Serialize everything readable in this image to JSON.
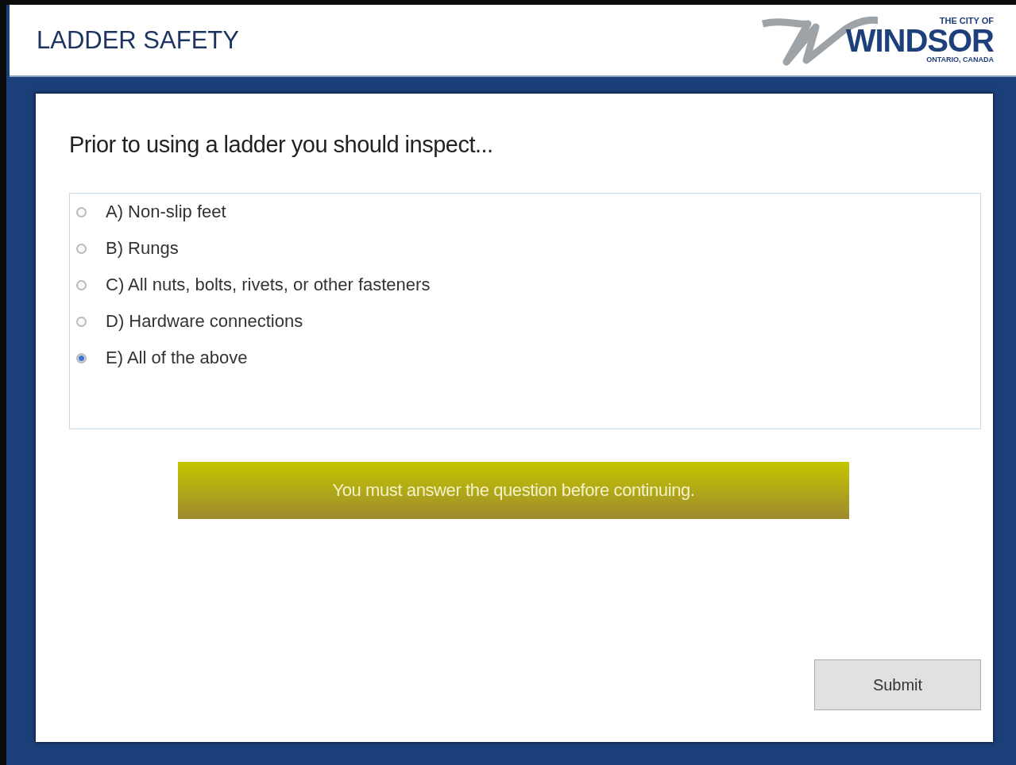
{
  "header": {
    "title": "LADDER SAFETY",
    "logo": {
      "top_line": "THE CITY OF",
      "name": "WINDSOR",
      "bottom_line": "ONTARIO, CANADA"
    }
  },
  "question": {
    "prompt": "Prior to using a ladder you should inspect...",
    "options": [
      {
        "label": "A) Non-slip feet",
        "selected": false
      },
      {
        "label": "B) Rungs",
        "selected": false
      },
      {
        "label": "C) All nuts, bolts, rivets, or other fasteners",
        "selected": false
      },
      {
        "label": "D) Hardware connections",
        "selected": false
      },
      {
        "label": "E) All of the above",
        "selected": true
      }
    ]
  },
  "alert": {
    "message": "You must answer the question before continuing."
  },
  "buttons": [
    {
      "label": "Submit"
    }
  ]
}
